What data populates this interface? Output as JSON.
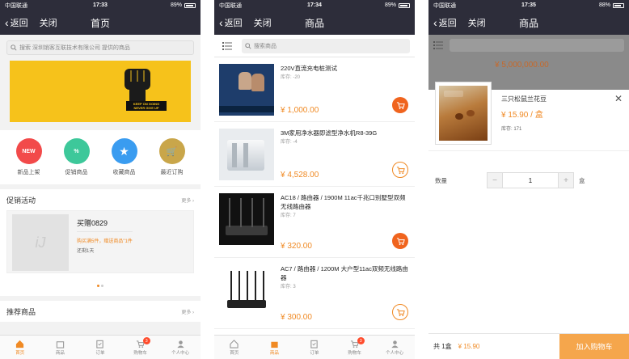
{
  "statusbar": {
    "s1": {
      "carrier": "中国联通",
      "time": "17:33",
      "battery": "89%"
    },
    "s2": {
      "carrier": "中国联通",
      "time": "17:34",
      "battery": "89%"
    },
    "s3": {
      "carrier": "中国联通",
      "time": "17:35",
      "battery": "88%"
    }
  },
  "nav": {
    "back": "返回",
    "close": "关闭",
    "home_title": "首页",
    "products_title": "商品"
  },
  "home": {
    "search_placeholder": "搜索  深圳销客互联技术有限公司  提供的商品",
    "banner_text_line1": "KEEP ON GOING",
    "banner_text_line2": "NEVER GIVE UP",
    "quick_links": [
      {
        "label": "新品上架",
        "icon_text": "NEW",
        "color": "#f24a4a"
      },
      {
        "label": "促销商品",
        "icon_text": "%",
        "color": "#3dc89a"
      },
      {
        "label": "收藏商品",
        "icon_text": "★",
        "color": "#3a9cf0"
      },
      {
        "label": "最近订购",
        "icon_text": "🛒",
        "color": "#c9a64a"
      }
    ],
    "promo_section_title": "促销活动",
    "more": "更多",
    "promo": {
      "placeholder": "iJ",
      "name": "买赠0829",
      "desc": "购买满5件，赠送商品\"1件",
      "days_left": "还剩1天"
    },
    "recommend_title": "推荐商品"
  },
  "tabs": [
    "首页",
    "商品",
    "订单",
    "购物车",
    "个人中心"
  ],
  "cart_count": "3",
  "products": {
    "search_placeholder": "搜索商品",
    "items": [
      {
        "name": "220V直流充电桩测试",
        "stock": "库存: -20",
        "price": "¥ 1,000.00"
      },
      {
        "name": "3M家用净水器即滤型净水机R8-39G",
        "stock": "库存: -4",
        "price": "¥ 4,528.00"
      },
      {
        "name": "AC18 / 路由器 / 1900M 11ac千兆口别墅型双频无线路由器",
        "stock": "库存: 7",
        "price": "¥ 320.00"
      },
      {
        "name": "AC7 / 路由器 / 1200M 大户型11ac双频无线路由器",
        "stock": "库存: 3",
        "price": "¥ 300.00"
      }
    ]
  },
  "sheet": {
    "bg_price": "¥ 5,000,000.00",
    "name": "三只松鼠兰花豆",
    "price": "¥ 15.90 / 盒",
    "stock": "库存: 171",
    "qty_label": "数量",
    "qty_minus": "−",
    "qty_value": "1",
    "qty_plus": "+",
    "unit": "盒",
    "total_label": "共 1盒",
    "total_amount": "¥ 15.90",
    "add_to_cart": "加入购物车",
    "close_symbol": "✕"
  }
}
